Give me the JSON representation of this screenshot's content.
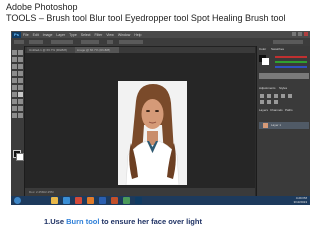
{
  "slide": {
    "title_line1": "Adobe Photoshop",
    "title_line2": "TOOLS – Brush tool  Blur tool  Eyedropper tool  Spot Healing Brush tool"
  },
  "photoshop": {
    "logo": "Ps",
    "menus": [
      "File",
      "Edit",
      "Image",
      "Layer",
      "Type",
      "Select",
      "Filter",
      "View",
      "Window",
      "Help"
    ],
    "document_tabs": [
      "Untitled-1 @ 66.7% (RGB/8)",
      "image @ 66.7% (RGB/8)"
    ],
    "status_text": "Doc: 2.25M/2.25M",
    "panel_tabs": [
      "Color",
      "Swatches",
      "Adjustments",
      "Styles",
      "Layers",
      "Channels",
      "Paths"
    ],
    "layer_name": "Layer 1",
    "clock_time": "4:29 PM",
    "clock_date": "3/13/2013",
    "colors": {
      "app_bg": "#2b2b2b",
      "panel_bg": "#3a3a3a",
      "taskbar": "#1d3a5c"
    }
  },
  "caption": {
    "prefix": "1.Use ",
    "tool": "Burn tool",
    "suffix": " to ensure her face over light",
    "tool_color": "#2e7fd8"
  }
}
